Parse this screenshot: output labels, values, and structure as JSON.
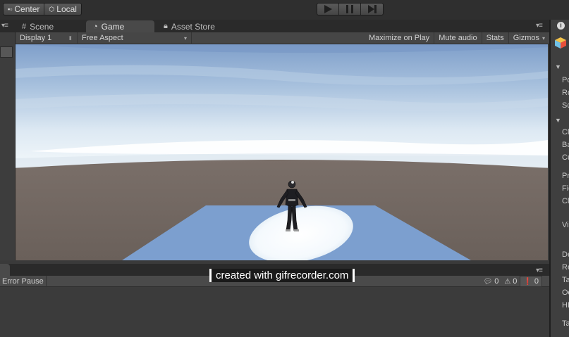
{
  "toolbar": {
    "pivot_label": "Center",
    "rotation_label": "Local"
  },
  "tabs": [
    {
      "label": "Scene",
      "icon": "grid-icon"
    },
    {
      "label": "Game",
      "icon": "pacman-icon"
    },
    {
      "label": "Asset Store",
      "icon": "lock-icon"
    }
  ],
  "gamebar": {
    "display": "Display 1",
    "aspect": "Free Aspect",
    "maximize": "Maximize on Play",
    "mute": "Mute audio",
    "stats": "Stats",
    "gizmos": "Gizmos"
  },
  "inspector": {
    "info_glyph": "i",
    "rows": [
      "Po",
      "Ro",
      "Sc",
      "Cl",
      "Ba",
      "Cu",
      "Pr",
      "Fie",
      "Cl",
      "Vi",
      "De",
      "Re",
      "Ta",
      "Oc",
      "HD",
      "Ta"
    ]
  },
  "console": {
    "error_pause": "Error Pause",
    "info_count": "0",
    "warning_count": "0",
    "error_count": "0"
  },
  "watermark": "created with gifrecorder.com",
  "colors": {
    "sky_top": "#7f9fca",
    "sky_horizon": "#f3f8fb",
    "ground": "#6f655f",
    "plane": "#7c9fcf",
    "spotlight": "#f4f9fd"
  }
}
